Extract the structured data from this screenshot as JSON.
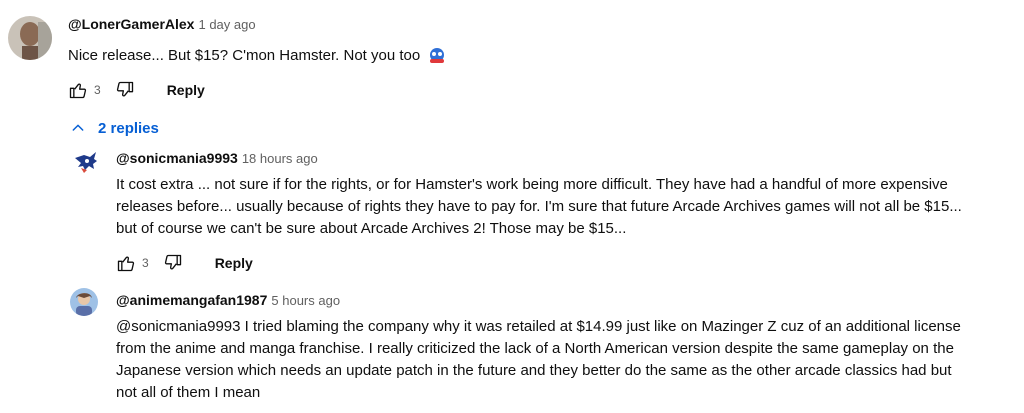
{
  "comments": [
    {
      "handle": "@LonerGamerAlex",
      "time": "1 day ago",
      "text": "Nice release... But $15? C'mon Hamster. Not you too",
      "emoji_icon": "sonic-emoji-icon",
      "likes": "3",
      "reply_label": "Reply"
    }
  ],
  "replies_toggle": {
    "label": "2 replies",
    "icon": "chevron-up-icon"
  },
  "replies": [
    {
      "handle": "@sonicmania9993",
      "time": "18 hours ago",
      "text_lines": [
        "It cost extra ... not sure if for the rights, or for Hamster's work being more difficult. They have had a handful of more expensive",
        "releases before... usually because of rights they have to pay for.  I'm sure that future Arcade Archives games will not all be $15...",
        "but of course we can't be sure about Arcade Archives 2!  Those may be $15..."
      ],
      "likes": "3",
      "reply_label": "Reply"
    },
    {
      "handle": "@animemangafan1987",
      "time": "5 hours ago",
      "text_lines": [
        "@sonicmania9993 I tried blaming the company why it was retailed at $14.99 just like on Mazinger Z cuz of an additional license",
        "from the anime and manga franchise.  I really criticized the lack of a North American version despite the same gameplay on the",
        "Japanese version which needs an update patch in the future and they better do the same as the other arcade classics had but",
        "not all of them I mean"
      ]
    }
  ],
  "colors": {
    "link": "#065fd4",
    "meta": "#606060",
    "text": "#0f0f0f"
  }
}
